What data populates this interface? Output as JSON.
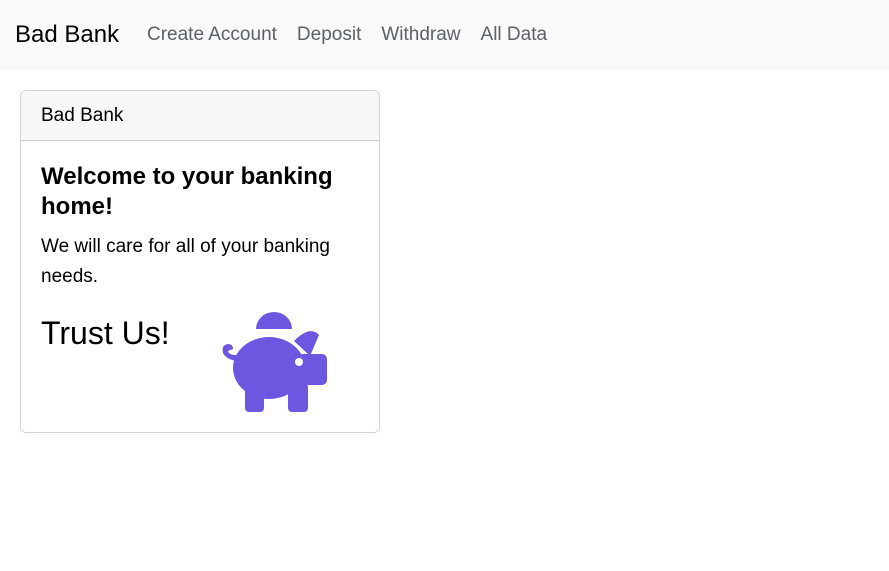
{
  "navbar": {
    "brand": "Bad Bank",
    "links": [
      {
        "label": "Create Account"
      },
      {
        "label": "Deposit"
      },
      {
        "label": "Withdraw"
      },
      {
        "label": "All Data"
      }
    ]
  },
  "card": {
    "header": "Bad Bank",
    "title": "Welcome to your banking home!",
    "text": "We will care for all of your banking needs.",
    "tagline": "Trust Us!",
    "image_icon": "piggy-bank-icon",
    "image_color": "#6e57e0"
  }
}
